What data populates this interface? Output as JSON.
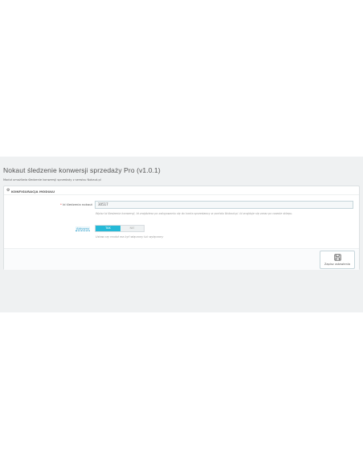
{
  "header": {
    "title": "Nokaut śledzenie konwersji sprzedaży Pro (v1.0.1)",
    "description": "Moduł umożliwia śledzenie konwersji sprzedaży z serwisu Nokaut.pl"
  },
  "panel": {
    "heading": "KONFIGURACJA MODUŁU",
    "heading_icon": "gears-icon"
  },
  "fields": {
    "tracking_id": {
      "required_mark": "*",
      "label": "Id śledzenia nokaut",
      "value": "30517",
      "help": "Wpisz Id śledzenia konwersji, Id znajdziesz po zalogowaniu się do konta sprzedawcy w portalu Nokaut.pl. Id znajduje się zaraz po nazwie sklepu."
    },
    "active": {
      "label": "Aktywny",
      "yes_label": "TAK",
      "no_label": "NIE",
      "selected": "TAK",
      "help": "Ustaw czy moduł ma być włączony lub wyłączony"
    }
  },
  "footer": {
    "save_label": "Zapisz ustawienia",
    "save_icon": "floppy-disk-icon"
  },
  "colors": {
    "accent": "#25b9d7",
    "admin_background": "#eff1f2",
    "required": "#e84a4a"
  }
}
